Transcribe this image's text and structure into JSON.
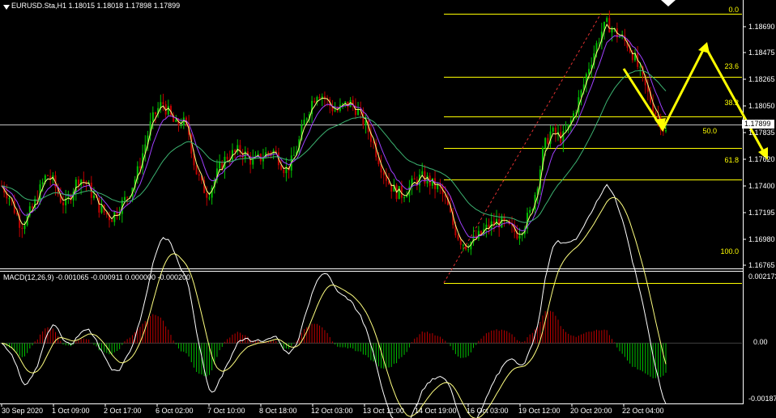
{
  "header": {
    "symbol_line": "EURUSD.Sta,H1  1.18015 1.18018 1.17898 1.17899"
  },
  "macd": {
    "label": "MACD(12,26,9) -0.001065 -0.000911 0.000000 -0.000200"
  },
  "price_axis": {
    "ticks": [
      "1.18690",
      "1.18475",
      "1.18265",
      "1.18050",
      "1.17835",
      "1.17620",
      "1.17400",
      "1.17195",
      "1.16980",
      "1.16765"
    ],
    "current_price": "1.17899"
  },
  "macd_axis": {
    "ticks": [
      "0.002173",
      "0.00",
      "-0.00187"
    ]
  },
  "time_axis": {
    "ticks": [
      "30 Sep 2020",
      "1 Oct 09:00",
      "2 Oct 17:00",
      "6 Oct 02:00",
      "7 Oct 10:00",
      "8 Oct 18:00",
      "12 Oct 03:00",
      "13 Oct 11:00",
      "14 Oct 19:00",
      "16 Oct 03:00",
      "19 Oct 12:00",
      "20 Oct 20:00",
      "22 Oct 04:00"
    ]
  },
  "fibonacci": {
    "levels": [
      "0.0",
      "23.6",
      "38.2",
      "50.0",
      "61.8",
      "100.0"
    ]
  },
  "colors": {
    "background": "#000000",
    "bull": "#00c000",
    "bear": "#c00000",
    "fib": "#ffff00",
    "ma_fast": "#ffff80",
    "ma_mid": "#a040ff",
    "ma_slow": "#3cb371",
    "arrows": "#ffff00"
  },
  "chart_data": {
    "type": "candlestick",
    "symbol": "EURUSD.Sta",
    "timeframe": "H1",
    "last_bar": {
      "open": 1.18015,
      "high": 1.18018,
      "low": 1.17898,
      "close": 1.17899
    },
    "ylim": [
      1.16765,
      1.1895
    ],
    "close_path": [
      1.1745,
      1.1738,
      1.1725,
      1.1712,
      1.1718,
      1.1728,
      1.1742,
      1.1755,
      1.1748,
      1.1735,
      1.1728,
      1.1742,
      1.1752,
      1.1748,
      1.1738,
      1.1728,
      1.1722,
      1.1718,
      1.1725,
      1.1732,
      1.1742,
      1.1755,
      1.1775,
      1.1795,
      1.1808,
      1.1815,
      1.1805,
      1.1795,
      1.18,
      1.179,
      1.176,
      1.1745,
      1.1738,
      1.175,
      1.1762,
      1.177,
      1.1772,
      1.1775,
      1.177,
      1.1765,
      1.1768,
      1.1772,
      1.1775,
      1.1768,
      1.1758,
      1.1765,
      1.178,
      1.18,
      1.1815,
      1.1825,
      1.182,
      1.1812,
      1.1808,
      1.1812,
      1.1815,
      1.181,
      1.18,
      1.179,
      1.1775,
      1.176,
      1.1748,
      1.174,
      1.1738,
      1.1742,
      1.1748,
      1.1752,
      1.175,
      1.1745,
      1.1742,
      1.173,
      1.1712,
      1.17,
      1.1695,
      1.1698,
      1.1702,
      1.1708,
      1.1712,
      1.1715,
      1.1712,
      1.1708,
      1.1705,
      1.1712,
      1.1722,
      1.1745,
      1.1775,
      1.179,
      1.1788,
      1.1785,
      1.1795,
      1.181,
      1.1825,
      1.1845,
      1.186,
      1.1875,
      1.1882,
      1.1875,
      1.187,
      1.1865,
      1.1855,
      1.184,
      1.1825,
      1.1812,
      1.18,
      1.179
    ],
    "macd": {
      "label": "MACD(12,26,9)",
      "value": -0.001065,
      "signal": -0.000911,
      "ylim": [
        -0.00187,
        0.002173
      ]
    },
    "fib_levels": [
      {
        "level": "0.0",
        "price": 1.18905
      },
      {
        "level": "23.6",
        "price": 1.1837
      },
      {
        "level": "38.2",
        "price": 1.18038
      },
      {
        "level": "50.0",
        "price": 1.1777
      },
      {
        "level": "61.8",
        "price": 1.175
      },
      {
        "level": "100.0",
        "price": 1.1663
      }
    ]
  }
}
